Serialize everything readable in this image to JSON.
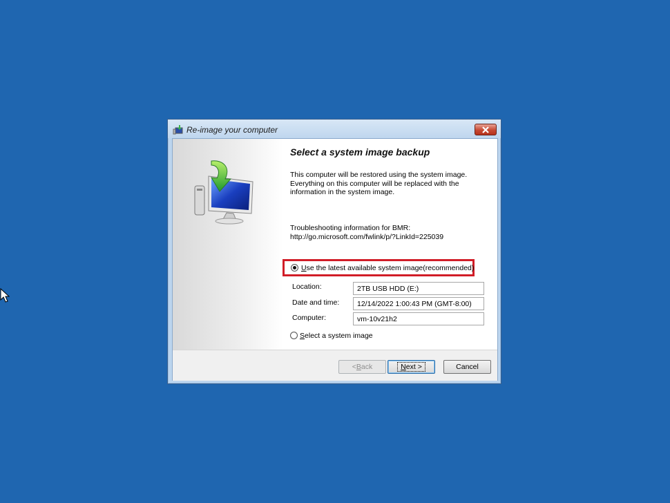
{
  "window": {
    "title": "Re-image your computer"
  },
  "wizard": {
    "heading": "Select a system image backup",
    "description": "This computer will be restored using the system image. Everything on this computer will be replaced with the information in the system image.",
    "troubleshooting_label": "Troubleshooting information for BMR:",
    "troubleshooting_link": "http://go.microsoft.com/fwlink/p/?LinkId=225039"
  },
  "options": {
    "latest": {
      "accel": "U",
      "rest": "se the latest available system image(recommended)",
      "selected": true
    },
    "select": {
      "accel": "S",
      "rest": "elect a system image",
      "selected": false
    }
  },
  "details": {
    "location_label": "Location:",
    "location_value": "2TB USB HDD (E:)",
    "datetime_label": "Date and time:",
    "datetime_value": "12/14/2022 1:00:43 PM (GMT-8:00)",
    "computer_label": "Computer:",
    "computer_value": "vm-10v21h2"
  },
  "buttons": {
    "back_prefix": "< ",
    "back_accel": "B",
    "back_rest": "ack",
    "next_accel": "N",
    "next_rest": "ext >",
    "cancel": "Cancel"
  },
  "colors": {
    "desktop": "#1f66b0",
    "highlight_border": "#d11d27"
  }
}
